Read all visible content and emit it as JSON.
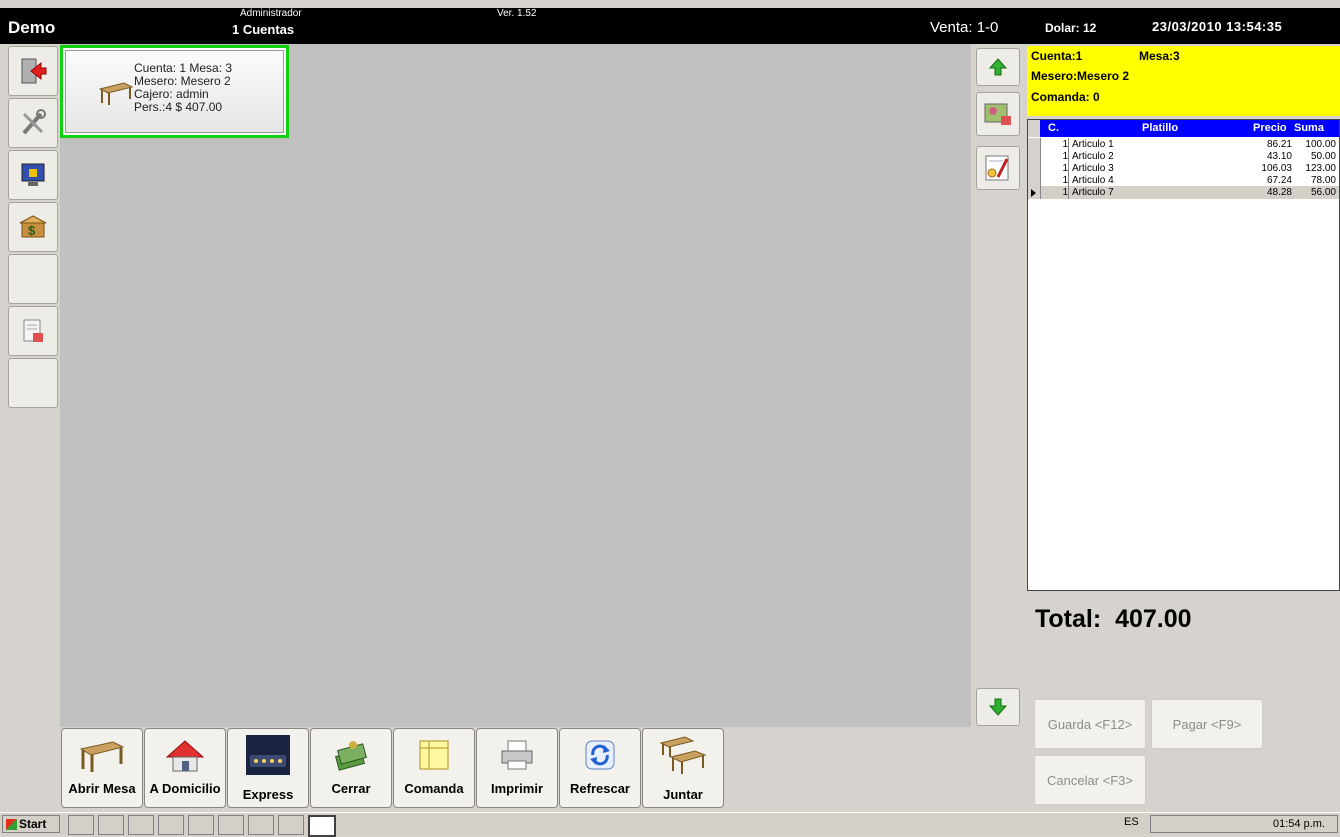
{
  "titlebar": {
    "app_name": "Demo",
    "user": "Administrador",
    "accounts": "1 Cuentas",
    "version": "Ver. 1.52",
    "venta": "Venta: 1-0",
    "dolar": "Dolar: 12",
    "datetime": "23/03/2010 13:54:35"
  },
  "sidebar": {
    "items": [
      {
        "name": "exit-icon"
      },
      {
        "name": "tools-icon"
      },
      {
        "name": "lock-monitor-icon"
      },
      {
        "name": "cash-box-icon"
      },
      {
        "name": "blank"
      },
      {
        "name": "cancel-document-icon"
      },
      {
        "name": "blank"
      }
    ]
  },
  "table_card": {
    "line1": "Cuenta: 1 Mesa: 3",
    "line2": "Mesero: Mesero 2",
    "line3": "Cajero: admin",
    "line4": "Pers.:4 $ 407.00"
  },
  "bottom_buttons": [
    {
      "label": "Abrir Mesa",
      "icon": "table-icon"
    },
    {
      "label": "A Domicilio",
      "icon": "house-icon"
    },
    {
      "label": "Express",
      "icon": "night-photo-icon"
    },
    {
      "label": "Cerrar",
      "icon": "money-stack-icon"
    },
    {
      "label": "Comanda",
      "icon": "order-sheet-icon"
    },
    {
      "label": "Imprimir",
      "icon": "printer-icon"
    },
    {
      "label": "Refrescar",
      "icon": "refresh-icon"
    },
    {
      "label": "Juntar",
      "icon": "join-tables-icon"
    }
  ],
  "order": {
    "cuenta": "Cuenta:1",
    "mesa": "Mesa:3",
    "mesero": "Mesero:Mesero 2",
    "comanda": "Comanda: 0",
    "columns": [
      "C.",
      "Platillo",
      "Precio",
      "Suma"
    ],
    "rows": [
      {
        "c": "1",
        "platillo": "Articulo 1",
        "precio": "86.21",
        "suma": "100.00"
      },
      {
        "c": "1",
        "platillo": "Articulo 2",
        "precio": "43.10",
        "suma": "50.00"
      },
      {
        "c": "1",
        "platillo": "Articulo 3",
        "precio": "106.03",
        "suma": "123.00"
      },
      {
        "c": "1",
        "platillo": "Articulo 4",
        "precio": "67.24",
        "suma": "78.00"
      },
      {
        "c": "1",
        "platillo": "Articulo 7",
        "precio": "48.28",
        "suma": "56.00"
      }
    ],
    "total_label": "Total:",
    "total_value": "407.00"
  },
  "actions": {
    "guarda": "Guarda <F12>",
    "pagar": "Pagar <F9>",
    "cancelar": "Cancelar <F3>"
  },
  "taskbar": {
    "start": "Start",
    "lang": "ES",
    "clock": "01:54 p.m."
  }
}
